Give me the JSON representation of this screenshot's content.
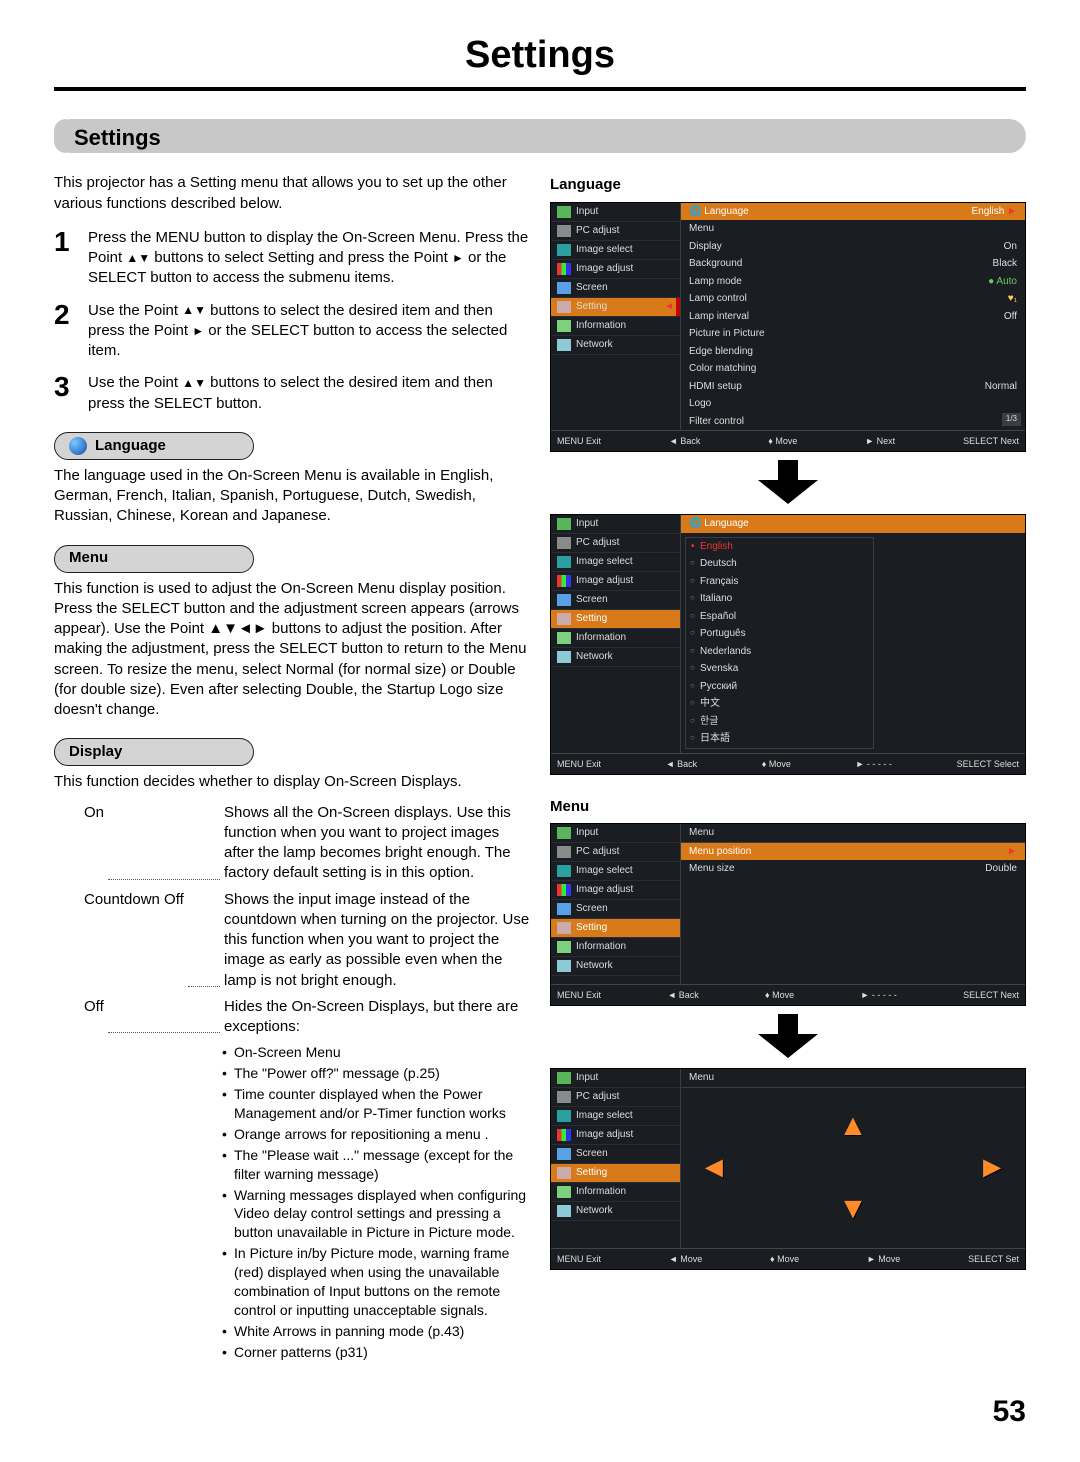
{
  "page_title": "Settings",
  "section_title": "Settings",
  "page_number": "53",
  "intro": "This projector has a Setting menu that allows you to set up the other various functions described below.",
  "steps": [
    {
      "num": "1",
      "text_parts": [
        "Press the MENU button to display the On-Screen Menu.  Press the Point ",
        " buttons to select Setting and press the Point ",
        " or the SELECT button to access the submenu items."
      ]
    },
    {
      "num": "2",
      "text_parts": [
        "Use the Point ",
        " buttons to select the desired item and then press the Point ",
        " or the SELECT button to access the selected item."
      ]
    },
    {
      "num": "3",
      "text_parts": [
        "Use the Point ",
        " buttons to select the desired item and then press the SELECT button."
      ]
    }
  ],
  "lang_heading": "Language",
  "lang_desc": "The language used in the On-Screen Menu is available in English, German, French, Italian, Spanish, Portuguese, Dutch, Swedish, Russian, Chinese, Korean and Japanese.",
  "menu_heading": "Menu",
  "menu_desc": "This function is used to adjust the On-Screen Menu display position. Press the SELECT button and the adjustment screen appears (arrows appear). Use the Point ▲▼◄► buttons to adjust the position. After making the adjustment, press the SELECT button to return to the Menu screen. To resize the menu, select Normal (for normal size) or Double (for double size). Even after selecting Double, the Startup Logo size doesn't change.",
  "display_heading": "Display",
  "display_intro": "This function decides whether to display On-Screen Displays.",
  "display_items": [
    {
      "term": "On",
      "def": "Shows all the On-Screen displays. Use this function when you want to project images after the lamp becomes bright enough. The factory default setting is in this option."
    },
    {
      "term": "Countdown Off",
      "def": "Shows the input image instead of the countdown when turning on the projector. Use this function when you want to project the image as early as possible even when the lamp is not bright enough."
    },
    {
      "term": "Off",
      "def": "Hides the On-Screen Displays, but there are exceptions:"
    }
  ],
  "exceptions": [
    "On-Screen Menu",
    "The \"Power off?\" message (p.25)",
    "Time counter displayed when the Power Management and/or P-Timer function works",
    "Orange arrows for repositioning a menu .",
    "The \"Please wait ...\" message (except for the filter warning message)",
    "Warning messages displayed when configuring Video delay control settings and pressing a button unavailable in Picture in Picture mode.",
    "In Picture in/by Picture mode, warning frame (red) displayed when using the unavailable combination of Input buttons on the remote control or inputting unacceptable signals.",
    "White Arrows in panning mode (p.43)",
    "Corner patterns (p31)"
  ],
  "right": {
    "heading_lang": "Language",
    "heading_menu": "Menu",
    "side_items": [
      "Input",
      "PC adjust",
      "Image select",
      "Image adjust",
      "Screen",
      "Setting",
      "Information",
      "Network"
    ],
    "osd1": {
      "title": "Language",
      "title_val": "English",
      "rows": [
        {
          "k": "Menu",
          "v": ""
        },
        {
          "k": "Display",
          "v": "On"
        },
        {
          "k": "Background",
          "v": "Black"
        },
        {
          "k": "Lamp mode",
          "v": "Auto"
        },
        {
          "k": "Lamp control",
          "v": ""
        },
        {
          "k": "Lamp interval",
          "v": "Off"
        },
        {
          "k": "Picture in Picture",
          "v": ""
        },
        {
          "k": "Edge blending",
          "v": ""
        },
        {
          "k": "Color matching",
          "v": ""
        },
        {
          "k": "HDMI setup",
          "v": "Normal"
        },
        {
          "k": "Logo",
          "v": ""
        },
        {
          "k": "Filter control",
          "v": ""
        }
      ],
      "page_badge": "1/3",
      "footer": [
        "MENU Exit",
        "◄ Back",
        "♦ Move",
        "► Next",
        "SELECT Next"
      ]
    },
    "osd2": {
      "title": "Language",
      "langs": [
        "English",
        "Deutsch",
        "Français",
        "Italiano",
        "Español",
        "Português",
        "Nederlands",
        "Svenska",
        "Русский",
        "中文",
        "한글",
        "日本語"
      ],
      "footer": [
        "MENU Exit",
        "◄ Back",
        "♦ Move",
        "► - - - - -",
        "SELECT Select"
      ]
    },
    "osd3": {
      "title": "Menu",
      "rows": [
        {
          "k": "Menu position",
          "v": ""
        },
        {
          "k": "Menu size",
          "v": "Double"
        }
      ],
      "footer": [
        "MENU Exit",
        "◄ Back",
        "♦ Move",
        "► - - - - -",
        "SELECT Next"
      ]
    },
    "osd4": {
      "title": "Menu",
      "footer": [
        "MENU Exit",
        "◄ Move",
        "♦ Move",
        "► Move",
        "SELECT Set"
      ]
    }
  }
}
